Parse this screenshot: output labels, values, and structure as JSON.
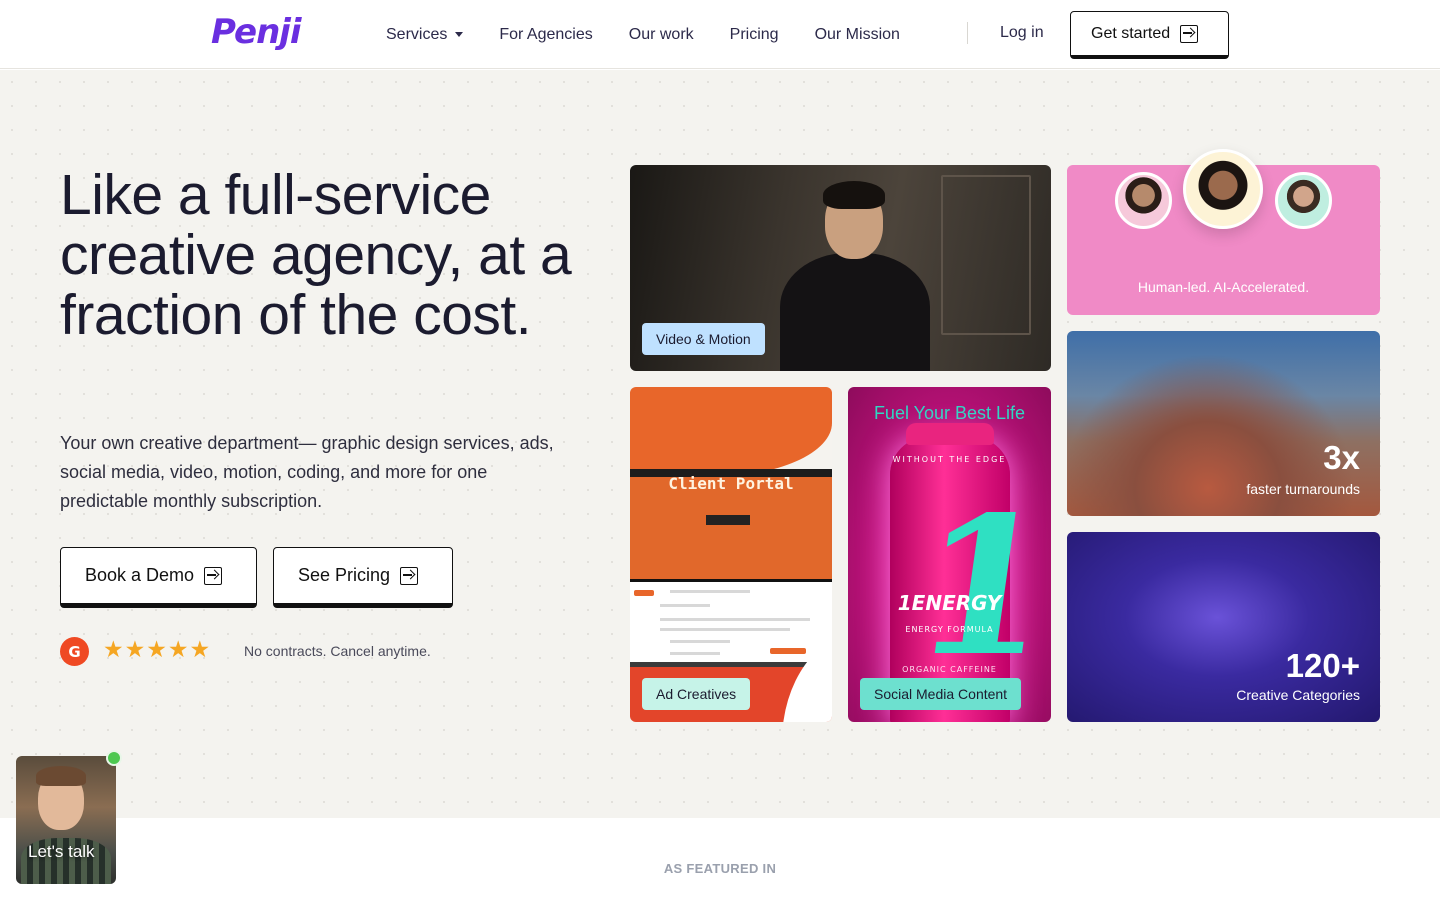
{
  "header": {
    "logo": "Penji",
    "nav": [
      "Services",
      "For Agencies",
      "Our work",
      "Pricing",
      "Our Mission"
    ],
    "login": "Log in",
    "get_started": "Get started"
  },
  "hero": {
    "headline": "Like a full-service creative agency, at a fraction of the cost.",
    "subtext": "Your own creative department— graphic design services, ads, social media, video, motion, coding, and more for one predictable monthly subscription.",
    "cta_demo": "Book a Demo",
    "cta_pricing": "See Pricing",
    "rating_logo": "G",
    "rating_stars": "★★★★★",
    "rating_value": 4.5,
    "contracts": "No contracts. Cancel anytime."
  },
  "tiles": {
    "video_tag": "Video & Motion",
    "human_caption": "Human-led. AI-Accelerated.",
    "faster_num": "3x",
    "faster_label": "faster turnarounds",
    "client_portal_title": "Client Portal",
    "ad_tag": "Ad Creatives",
    "energy_title": "Fuel Your Best Life",
    "energy_edge": "WITHOUT THE EDGE",
    "energy_one": "1",
    "energy_brand": "1ENERGY",
    "energy_formula": "ENERGY FORMULA",
    "energy_organic": "ORGANIC CAFFEINE",
    "social_tag": "Social Media Content",
    "categories_num": "120+",
    "categories_label": "Creative Categories"
  },
  "featured": {
    "label": "AS FEATURED IN"
  },
  "chat": {
    "label": "Let's talk"
  },
  "colors": {
    "brand": "#6a2fe0",
    "human_tile": "#f08ac6",
    "video_tag": "#bfe1ff",
    "ad_tag": "#c6f3e8",
    "social_tag": "#6de0cf",
    "online_dot": "#4cc850"
  }
}
